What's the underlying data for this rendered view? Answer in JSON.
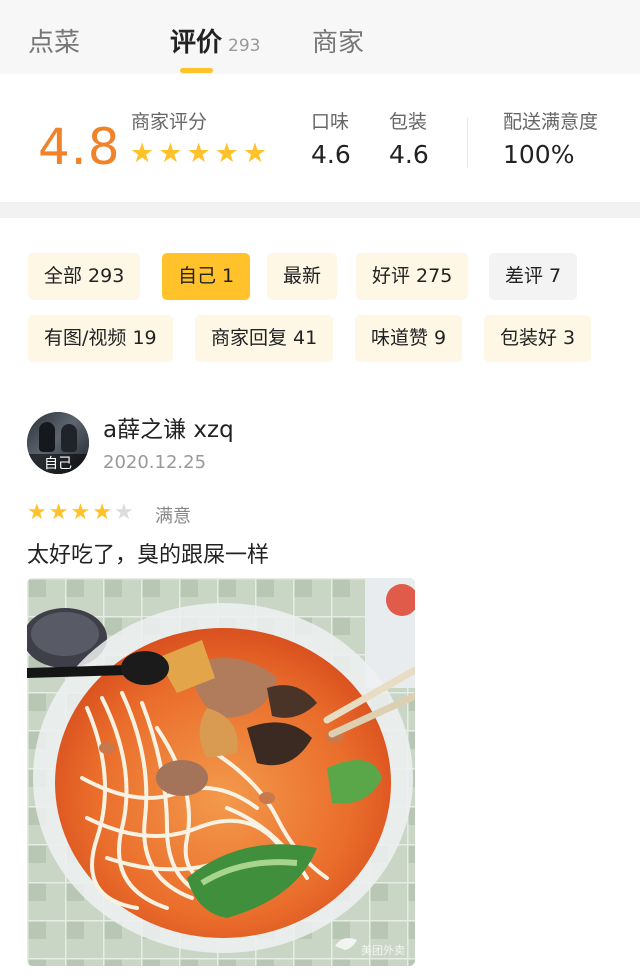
{
  "tabs": [
    {
      "label": "点菜"
    },
    {
      "label": "评价",
      "count": "293"
    },
    {
      "label": "商家"
    }
  ],
  "score": {
    "overall": "4.8",
    "merchant_label": "商家评分",
    "merchant_stars": 4.8,
    "taste_label": "口味",
    "taste_value": "4.6",
    "package_label": "包装",
    "package_value": "4.6",
    "delivery_label": "配送满意度",
    "delivery_value": "100%"
  },
  "filters": [
    {
      "label": "全部 293"
    },
    {
      "label": "自己 1",
      "selected": true
    },
    {
      "label": "最新"
    },
    {
      "label": "好评 275"
    },
    {
      "label": "差评 7"
    },
    {
      "label": "有图/视频 19"
    },
    {
      "label": "商家回复 41"
    },
    {
      "label": "味道赞 9"
    },
    {
      "label": "包装好 3"
    }
  ],
  "review": {
    "avatar_tag": "自己",
    "username": "a薛之谦 xzq",
    "date": "2020.12.25",
    "rating": 4,
    "rating_word": "满意",
    "text": "太好吃了，臭的跟屎一样",
    "photo_watermark": "美团外卖"
  },
  "colors": {
    "accent": "#ffc22b",
    "score_orange": "#f0822a",
    "chip_bg": "#fef7e5"
  }
}
